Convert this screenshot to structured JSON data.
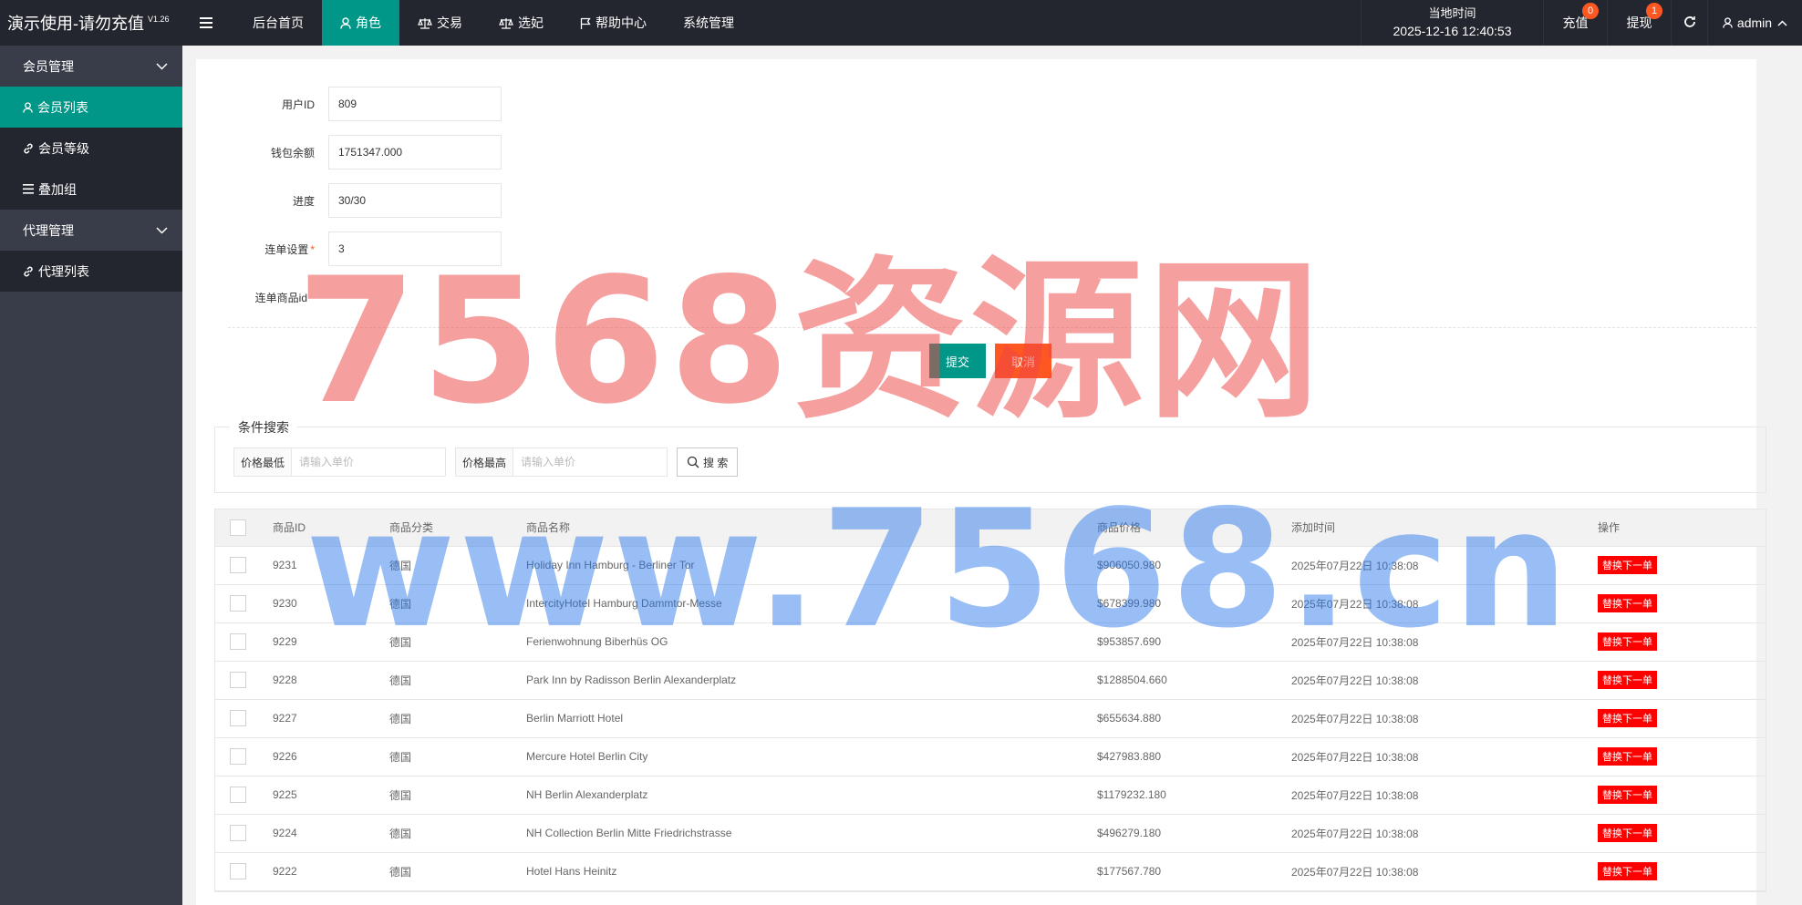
{
  "app": {
    "title": "演示使用-请勿充值",
    "version": "V1.26"
  },
  "nav": {
    "items": [
      {
        "label": "后台首页",
        "icon": ""
      },
      {
        "label": "角色",
        "icon": "user-icon"
      },
      {
        "label": "交易",
        "icon": "scale-icon"
      },
      {
        "label": "选妃",
        "icon": "scale-icon"
      },
      {
        "label": "帮助中心",
        "icon": "flag-icon"
      },
      {
        "label": "系统管理",
        "icon": ""
      }
    ],
    "active_index": 1,
    "time_label": "当地时间",
    "time_value": "2025-12-16 12:40:53",
    "recharge_label": "充值",
    "recharge_badge": "0",
    "withdraw_label": "提现",
    "withdraw_badge": "1",
    "user_label": "admin"
  },
  "sidebar": {
    "groups": [
      {
        "label": "会员管理",
        "items": [
          {
            "label": "会员列表",
            "icon": "user-icon"
          },
          {
            "label": "会员等级",
            "icon": "link-icon"
          },
          {
            "label": "叠加组",
            "icon": "list-icon"
          }
        ]
      },
      {
        "label": "代理管理",
        "items": [
          {
            "label": "代理列表",
            "icon": "link-icon"
          }
        ]
      }
    ]
  },
  "form": {
    "user_id_label": "用户ID",
    "user_id_value": "809",
    "balance_label": "钱包余额",
    "balance_value": "1751347.000",
    "progress_label": "进度",
    "progress_value": "30/30",
    "chain_label": "连单设置",
    "chain_value": "3",
    "chain_goods_label": "连单商品id",
    "submit_label": "提交",
    "cancel_label": "取消"
  },
  "search": {
    "legend": "条件搜索",
    "min_label": "价格最低",
    "min_placeholder": "请输入单价",
    "max_label": "价格最高",
    "max_placeholder": "请输入单价",
    "button_label": "搜 索"
  },
  "table": {
    "headers": [
      "商品ID",
      "商品分类",
      "商品名称",
      "商品价格",
      "添加时间",
      "操作"
    ],
    "action_label": "替换下一单",
    "rows": [
      {
        "id": "9231",
        "category": "德国",
        "name": "Holiday Inn Hamburg - Berliner Tor",
        "price": "$906050.980",
        "time": "2025年07月22日 10:38:08"
      },
      {
        "id": "9230",
        "category": "德国",
        "name": "IntercityHotel Hamburg Dammtor-Messe",
        "price": "$678399.980",
        "time": "2025年07月22日 10:38:08"
      },
      {
        "id": "9229",
        "category": "德国",
        "name": "Ferienwohnung Biberhüs OG",
        "price": "$953857.690",
        "time": "2025年07月22日 10:38:08"
      },
      {
        "id": "9228",
        "category": "德国",
        "name": "Park Inn by Radisson Berlin Alexanderplatz",
        "price": "$1288504.660",
        "time": "2025年07月22日 10:38:08"
      },
      {
        "id": "9227",
        "category": "德国",
        "name": "Berlin Marriott Hotel",
        "price": "$655634.880",
        "time": "2025年07月22日 10:38:08"
      },
      {
        "id": "9226",
        "category": "德国",
        "name": "Mercure Hotel Berlin City",
        "price": "$427983.880",
        "time": "2025年07月22日 10:38:08"
      },
      {
        "id": "9225",
        "category": "德国",
        "name": "NH Berlin Alexanderplatz",
        "price": "$1179232.180",
        "time": "2025年07月22日 10:38:08"
      },
      {
        "id": "9224",
        "category": "德国",
        "name": "NH Collection Berlin Mitte Friedrichstrasse",
        "price": "$496279.180",
        "time": "2025年07月22日 10:38:08"
      },
      {
        "id": "9222",
        "category": "德国",
        "name": "Hotel Hans Heinitz",
        "price": "$177567.780",
        "time": "2025年07月22日 10:38:08"
      }
    ]
  },
  "watermark": {
    "line1": "7568资源网",
    "line2": "www.7568.cn"
  },
  "colors": {
    "header": "#23262e",
    "sidebar": "#393d49",
    "accent": "#009688",
    "danger": "#ff5722",
    "row_button": "#ff0000"
  }
}
